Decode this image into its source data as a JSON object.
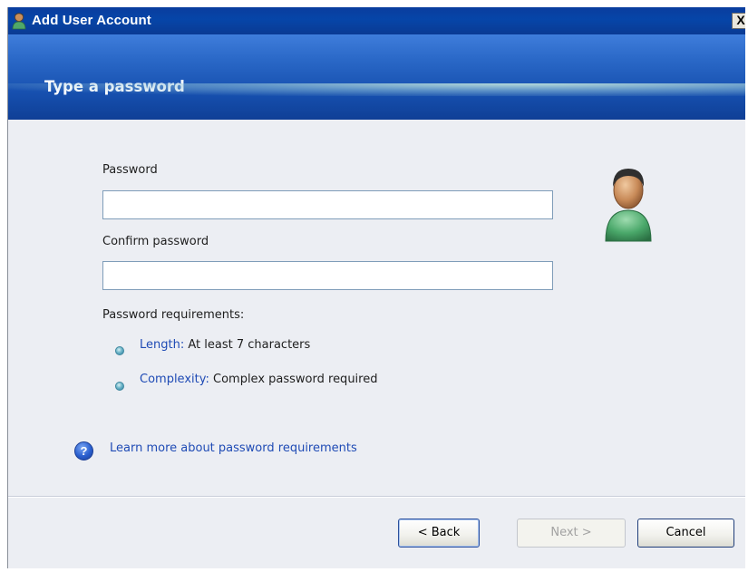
{
  "window": {
    "title": "Add User Account",
    "close_label": "X"
  },
  "banner": {
    "title": "Type a password"
  },
  "form": {
    "password": {
      "label": "Password",
      "value": ""
    },
    "confirm_password": {
      "label": "Confirm password",
      "value": ""
    }
  },
  "requirements": {
    "heading": "Password requirements:",
    "items": [
      {
        "name": "Length:",
        "text": "At least 7 characters"
      },
      {
        "name": "Complexity:",
        "text": "Complex password required"
      }
    ]
  },
  "help": {
    "icon_glyph": "?",
    "link_text": "Learn more about password requirements"
  },
  "buttons": {
    "back": "< Back",
    "next": "Next >",
    "cancel": "Cancel"
  },
  "icons": {
    "app": "user-icon",
    "avatar": "user-avatar-icon",
    "bullet": "bullet-icon",
    "help": "help-icon"
  },
  "colors": {
    "titlebar": "#0645a8",
    "banner": "#164fae",
    "link": "#1f4bb5",
    "panel": "#eceef3"
  }
}
